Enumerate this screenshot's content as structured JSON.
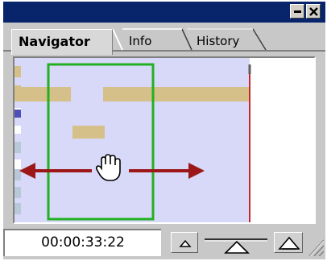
{
  "window": {
    "title_buttons": [
      "minimize-icon",
      "close-icon"
    ]
  },
  "tabs": [
    {
      "label": "Navigator",
      "active": true
    },
    {
      "label": "Info",
      "active": false
    },
    {
      "label": "History",
      "active": false
    }
  ],
  "navigator": {
    "view_box_color": "#22b022",
    "playhead_color": "#c82828",
    "clip_color": "#d4c088",
    "preview_bg": "#d8d8f8",
    "pan_arrows_color": "#9c1818",
    "cursor_icon": "hand-grab-icon"
  },
  "footer": {
    "timecode": "00:00:33:22",
    "zoom_out_icon": "zoom-out-mountain-icon",
    "zoom_slider_icon": "zoom-slider-icon",
    "zoom_in_icon": "zoom-in-mountain-icon",
    "resize_icon": "resize-grip-icon"
  }
}
